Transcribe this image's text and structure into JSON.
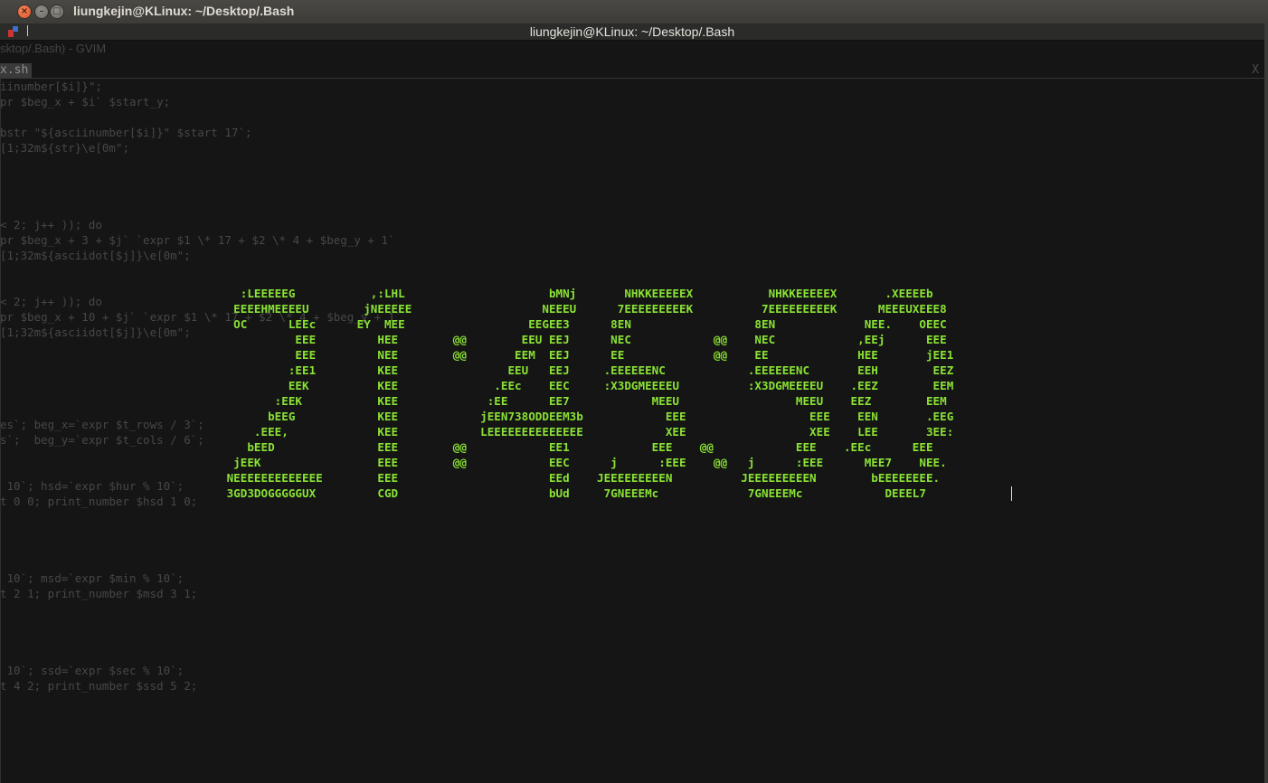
{
  "outer_window": {
    "title": "liungkejin@KLinux: ~/Desktop/.Bash",
    "close_glyph": "×",
    "minimize_glyph": "–",
    "maximize_glyph": "□"
  },
  "terminal": {
    "title": "liungkejin@KLinux: ~/Desktop/.Bash"
  },
  "gvim": {
    "window_title": "sktop/.Bash) - GVIM",
    "tab_label": "x.sh",
    "tab_close": "X",
    "code_lines": [
      "iinumber[$i]}\";",
      "pr $beg_x + $i` $start_y;",
      "bstr \"${asciinumber[$i]}\" $start 17`;",
      "[1;32m${str}\\e[0m\";",
      "< 2; j++ )); do",
      "pr $beg_x + 3 + $j` `expr $1 \\* 17 + $2 \\* 4 + $beg_y + 1`",
      "[1;32m${asciidot[$j]}\\e[0m\";",
      "< 2; j++ )); do",
      "pr $beg_x + 10 + $j` `expr $1 \\* 17 + $2 \\* 4 + $beg_y + 1`",
      "[1;32m${asciidot[$j]}\\e[0m\";",
      "es`; beg_x=`expr $t_rows / 3`;",
      "s`;  beg_y=`expr $t_cols / 6`;",
      " 10`; hsd=`expr $hur % 10`;",
      "t 0 0; print_number $hsd 1 0;",
      " 10`; msd=`expr $min % 10`;",
      "t 2 1; print_number $msd 3 1;",
      " 10`; ssd=`expr $sec % 10`;",
      "t 4 2; print_number $ssd 5 2;"
    ]
  },
  "clock_display": {
    "text_color": "#8ae234",
    "art_lines": [
      "   :LEEEEEG           ,:LHL                     bMNj       NHKKEEEEEX           NHKKEEEEEX       .XEEEEb",
      "  EEEEHMEEEEU        jNEEEEE                   NEEEU      7EEEEEEEEEK          7EEEEEEEEEK      MEEEUXEEE8",
      "  OC      LEEc      EY  MEE                  EEGEE3      8EN                  8EN             NEE.    OEEC",
      "           EEE         HEE        @@        EEU EEJ      NEC            @@    NEC            ,EEj      EEE",
      "           EEE         NEE        @@       EEM  EEJ      EE             @@    EE             HEE       jEE1",
      "          :EE1         KEE                EEU   EEJ     .EEEEEENC            .EEEEEENC       EEH        EEZ",
      "          EEK          KEE              .EEc    EEC     :X3DGMEEEEU          :X3DGMEEEEU    .EEZ        EEM",
      "        :EEK           KEE             :EE      EE7            MEEU                 MEEU    EEZ        EEM",
      "       bEEG            KEE            jEEN738ODDEEM3b            EEE                  EEE    EEN       .EEG",
      "     .EEE,             KEE            LEEEEEEEEEEEEEE            XEE                  XEE    LEE       3EE:",
      "    bEED               EEE        @@            EE1            EEE    @@            EEE    .EEc      EEE",
      "  jEEK                 EEE        @@            EEC      j      :EEE    @@   j      :EEE      MEE7    NEE.",
      " NEEEEEEEEEEEEE        EEE                      EEd    JEEEEEEEEEN          JEEEEEEEEEN        bEEEEEEEE.",
      " 3GD3DOGGGGGUX         CGD                      bUd     7GNEEEMc             7GNEEEMc            DEEEL7"
    ]
  }
}
